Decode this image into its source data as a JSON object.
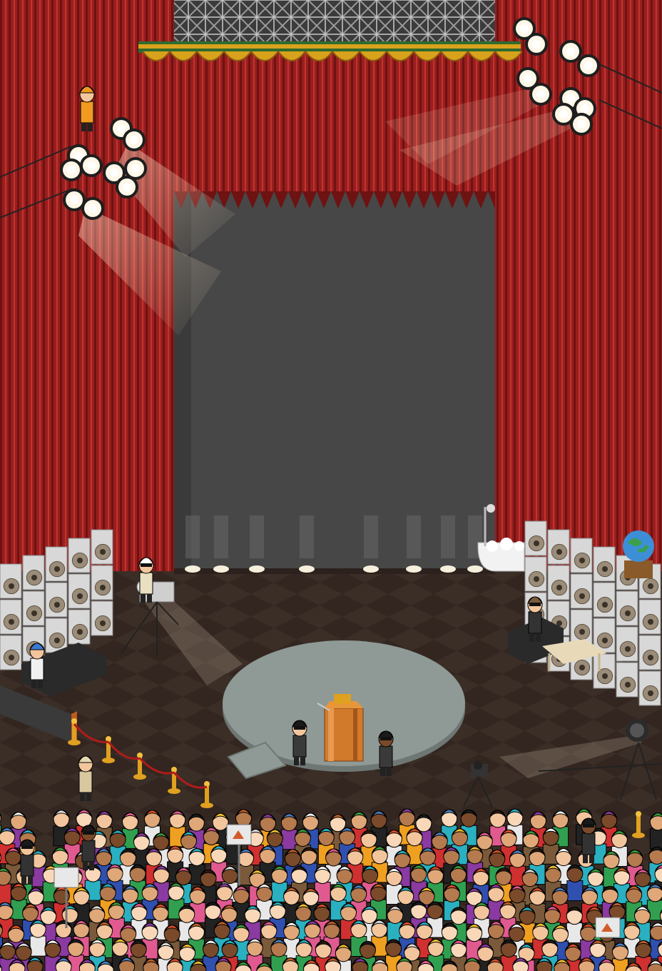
{
  "scene": {
    "type": "isometric-pixel-room",
    "theme": "theatre-stage",
    "colors": {
      "curtain": "#9a1e1e",
      "curtain_dark": "#6e1212",
      "curtain_light": "#c0352f",
      "backdrop": "#474747",
      "backdrop_dark": "#3a3a3a",
      "floor_a": "#3b2e27",
      "floor_b": "#332620",
      "stage_disc": "#8f9a96",
      "speaker_frame": "#d8d8d8",
      "speaker_cone": "#9a8c78",
      "sofa": "#2a2a2a",
      "rope": "#b01b1b",
      "post": "#e0a020",
      "light_beam": "#fff1dc",
      "podium": "#d27a2c",
      "valance_gold": "#d9a21c",
      "valance_green": "#2e6b2e"
    },
    "icons": [
      "stage-spotlight-icon",
      "speaker-stack-icon",
      "film-camera-icon",
      "globe-icon",
      "bathtub-icon",
      "podium-icon",
      "velvet-rope-icon",
      "avatar-icon",
      "sign-board-icon"
    ]
  }
}
